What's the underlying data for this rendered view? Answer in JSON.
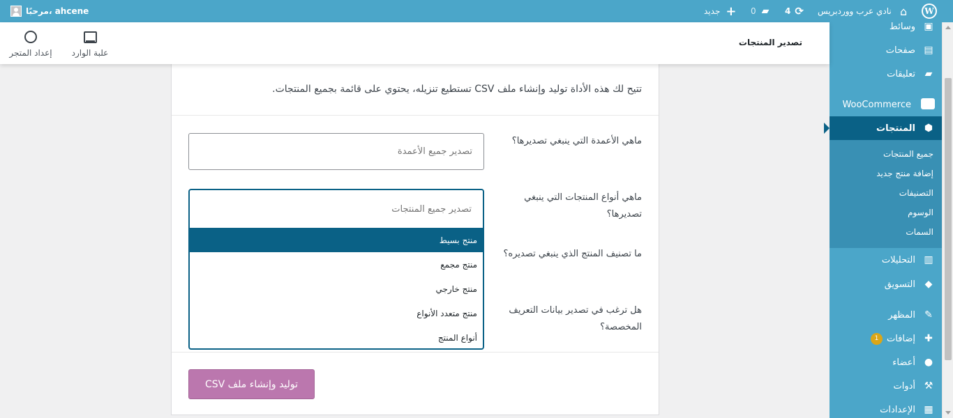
{
  "adminbar": {
    "site_name": "نادي عرب ووردبريس",
    "updates_count": "4",
    "comments_count": "0",
    "new_label": "جديد",
    "greeting": "مرحبًا، ahcene"
  },
  "header": {
    "page_title": "تصدير المنتجات",
    "inbox_label": "علبة الوارد",
    "setup_label": "إعداد المتجر"
  },
  "sidebar": {
    "items": [
      {
        "label": "وسائط",
        "icon": "media-icon"
      },
      {
        "label": "صفحات",
        "icon": "pages-icon"
      },
      {
        "label": "تعليقات",
        "icon": "comments-icon"
      },
      {
        "label": "WooCommerce",
        "icon": "woocommerce-icon"
      },
      {
        "label": "المنتجات",
        "icon": "products-icon"
      },
      {
        "label": "التحليلات",
        "icon": "analytics-icon"
      },
      {
        "label": "التسويق",
        "icon": "marketing-icon"
      },
      {
        "label": "المظهر",
        "icon": "appearance-icon"
      },
      {
        "label": "إضافات",
        "icon": "plugins-icon",
        "badge": "1"
      },
      {
        "label": "أعضاء",
        "icon": "users-icon"
      },
      {
        "label": "أدوات",
        "icon": "tools-icon"
      },
      {
        "label": "الإعدادات",
        "icon": "settings-icon"
      }
    ],
    "submenu": [
      "جميع المنتجات",
      "إضافة منتج جديد",
      "التصنيفات",
      "الوسوم",
      "السمات"
    ]
  },
  "main": {
    "intro": "تتيح لك هذه الأداة توليد وإنشاء ملف CSV تستطيع تنزيله، يحتوي على قائمة بجميع المنتجات.",
    "q_columns": "ماهي الأعمدة التي ينبغي تصديرها؟",
    "columns_placeholder": "تصدير جميع الأعمدة",
    "q_types": "ماهي أنواع المنتجات التي ينبغي تصديرها؟",
    "types_placeholder": "تصدير جميع المنتجات",
    "q_category": "ما تصنيف المنتج الذي ينبغي تصديره؟",
    "q_meta": "هل ترغب في تصدير بيانات التعريف المخصصة؟",
    "options": [
      "منتج بسيط",
      "منتج مجمع",
      "منتج خارجي",
      "منتج متعدد الأنواع",
      "أنواع المنتج"
    ],
    "selected_option": "منتج بسيط",
    "button_label": "توليد وإنشاء ملف CSV"
  },
  "colors": {
    "adminbar": "#4ba6c9",
    "active_menu": "#0a6186",
    "primary_button": "#bb77ae",
    "badge": "#dba617"
  }
}
